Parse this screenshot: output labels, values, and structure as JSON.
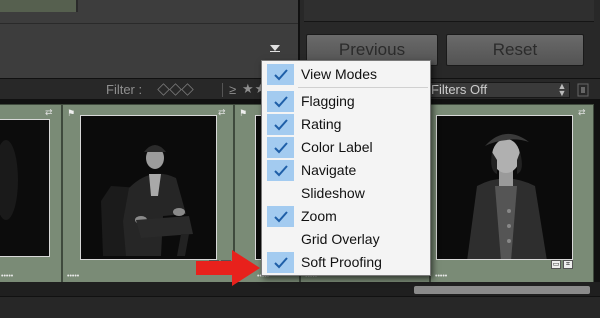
{
  "toolbar": {
    "menu_trigger_icon": "triangle-down-icon",
    "previous_label": "Previous",
    "reset_label": "Reset"
  },
  "filter_bar": {
    "filter_label": "Filter :",
    "rating_operator": "≥",
    "rating_stars": "★★",
    "preset_value": "Filters Off",
    "stepper_icon": "updown-stepper-icon"
  },
  "filmstrip": {
    "cells": [
      {
        "rating_dots": "•••••",
        "flag_icon": "flag-icon",
        "rotate_icon": "rotate-icon"
      },
      {
        "rating_dots": "•••••",
        "flag_icon": "flag-icon",
        "rotate_icon": "rotate-icon"
      },
      {
        "rating_dots": "•••••",
        "flag_icon": "flag-icon",
        "rotate_icon": "rotate-icon"
      },
      {
        "rating_dots": "•••••",
        "flag_icon": "flag-icon",
        "rotate_icon": "rotate-icon"
      },
      {
        "rating_dots": "•••••",
        "flag_icon": "flag-icon",
        "rotate_icon": "rotate-icon"
      }
    ]
  },
  "menu": {
    "items": [
      {
        "label": "View Modes",
        "checked": true
      },
      {
        "label": "Flagging",
        "checked": true
      },
      {
        "label": "Rating",
        "checked": true
      },
      {
        "label": "Color Label",
        "checked": true
      },
      {
        "label": "Navigate",
        "checked": true
      },
      {
        "label": "Slideshow",
        "checked": false
      },
      {
        "label": "Zoom",
        "checked": true
      },
      {
        "label": "Grid Overlay",
        "checked": false
      },
      {
        "label": "Soft Proofing",
        "checked": true
      }
    ]
  },
  "annotation": {
    "arrow_icon": "red-arrow-icon",
    "color": "#e8211c"
  },
  "colors": {
    "menu_check_highlight": "#a3cbf0",
    "filmstrip_cell": "#7a8b76",
    "check_mark": "#1f5fa8"
  }
}
